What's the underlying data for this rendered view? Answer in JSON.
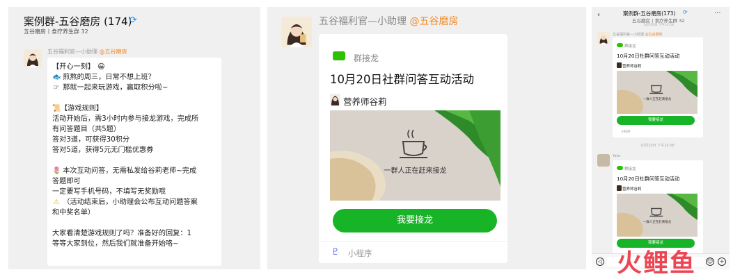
{
  "panel1": {
    "title": "案例群-五谷磨房 (174)",
    "subtitle": "五谷磨房丨食疗养生群 32",
    "sender_name": "五谷福利官—小助理",
    "sender_tag": "@五谷磨房",
    "message_lines": [
      "【开心一刻】",
      "煎熬的周三，日常不想上班？",
      "那就一起来玩游戏，赢取积分啦~",
      "",
      "【游戏规则】",
      "活动开始后，需3小时内参与接龙游戏，完成所",
      "有问答题目（共5题）",
      "答对3道，可获得30积分",
      "答对5道，获得5元无门槛优惠券",
      "",
      "本次互动问答，无需私发给谷莉老师~完成",
      "答题即可",
      "一定要写手机号码，不填写无奖励哦",
      "（活动结束后，小助理会公布互动问题答案",
      "和中奖名单）",
      "",
      "大家看清楚游戏规则了吗？准备好的回复：1",
      "等等大家到位，然后我们就准备开始咯~"
    ]
  },
  "panel2": {
    "sender_name": "五谷福利官—小助理",
    "sender_tag": "@五谷磨房",
    "card_label": "群接龙",
    "card_title": "10月20日社群问答互动活动",
    "author": "营养师谷莉",
    "image_caption": "一群人正在赶来接龙",
    "button": "我要接龙",
    "footer": "小程序"
  },
  "panel3": {
    "title": "案例群-五谷磨房(173)",
    "subtitle": "五谷磨房丨食疗养生群 32",
    "time_top": "10月20日 下午14:58",
    "sender1": "五谷福利官—小助理",
    "sender1_tag": "@五谷磨房",
    "card_label": "群接龙",
    "card_title": "10月20日社群问答互动活动",
    "author": "营养师谷莉",
    "image_caption": "一群人正在赶来接龙",
    "button": "我要接龙",
    "footer": "小程序",
    "time_mid": "10月20日 下午14:58",
    "sender2": "Yoko"
  },
  "watermark": "火鲤鱼",
  "colors": {
    "wechat_green": "#2dc100",
    "button_green": "#18b427",
    "tag_orange": "#f08a24",
    "watermark_red": "#ec3d4c"
  }
}
